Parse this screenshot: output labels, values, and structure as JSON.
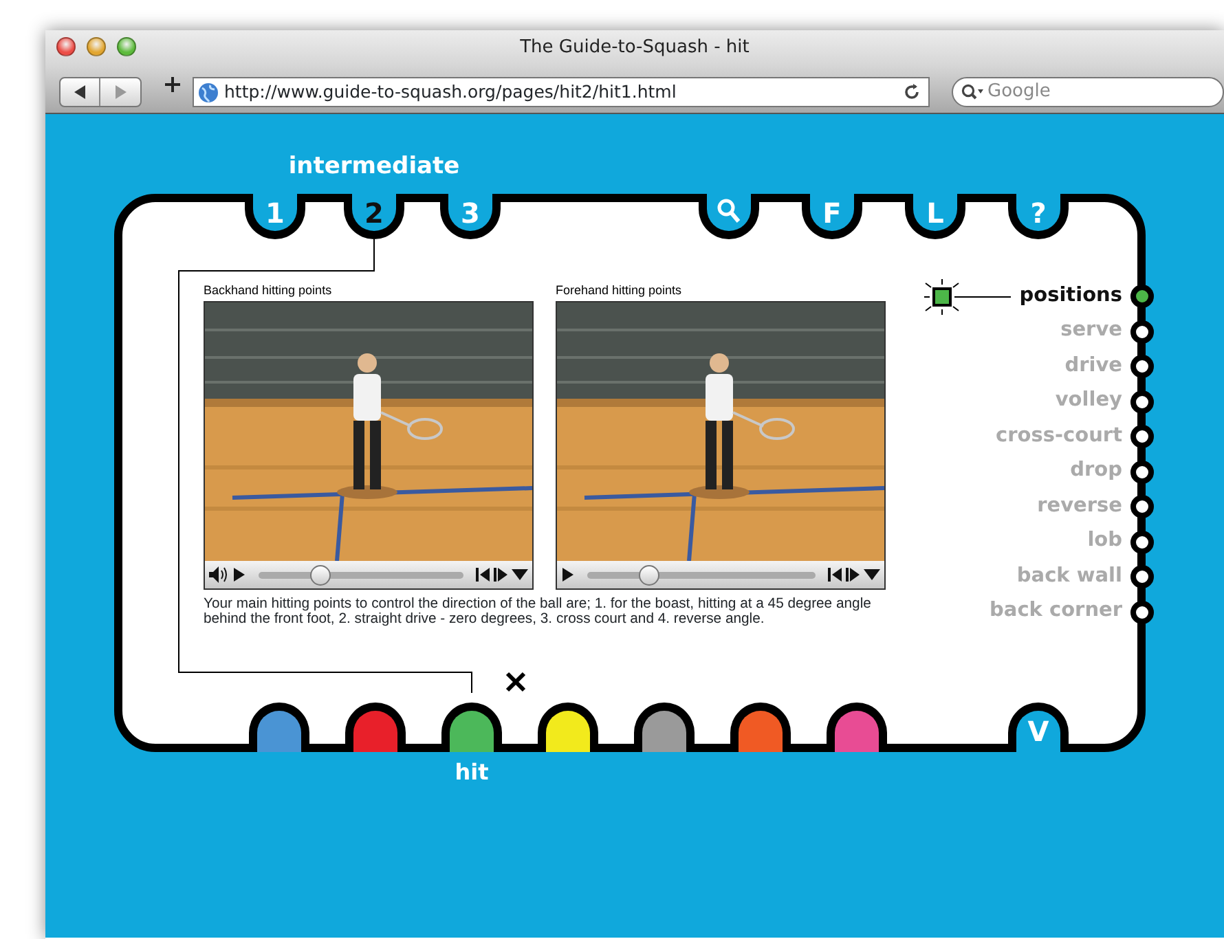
{
  "window": {
    "title": "The Guide-to-Squash - hit"
  },
  "toolbar": {
    "url": "http://www.guide-to-squash.org/pages/hit2/hit1.html",
    "search": {
      "placeholder": "Google"
    }
  },
  "level_label": "intermediate",
  "level_tabs": [
    {
      "label": "1",
      "selected": false
    },
    {
      "label": "2",
      "selected": true
    },
    {
      "label": "3",
      "selected": false
    }
  ],
  "tool_tabs": [
    {
      "kind": "search"
    },
    {
      "kind": "text",
      "label": "F"
    },
    {
      "kind": "text",
      "label": "L"
    },
    {
      "kind": "text",
      "label": "?"
    }
  ],
  "videos": [
    {
      "caption": "Backhand hitting points",
      "volume_button": true,
      "level": 0.3
    },
    {
      "caption": "Forehand hitting points",
      "volume_button": false,
      "level": 0.27
    }
  ],
  "description": "Your main hitting points to control the direction of the ball are; 1. for the boast, hitting at a 45 degree angle behind the front foot, 2. straight drive - zero degrees, 3. cross court and 4. reverse angle.",
  "topics": [
    {
      "label": "positions",
      "selected": true
    },
    {
      "label": "serve",
      "selected": false
    },
    {
      "label": "drive",
      "selected": false
    },
    {
      "label": "volley",
      "selected": false
    },
    {
      "label": "cross-court",
      "selected": false
    },
    {
      "label": "drop",
      "selected": false
    },
    {
      "label": "reverse",
      "selected": false
    },
    {
      "label": "lob",
      "selected": false
    },
    {
      "label": "back wall",
      "selected": false
    },
    {
      "label": "back corner",
      "selected": false
    }
  ],
  "sections": [
    {
      "color": "#4a94d4"
    },
    {
      "color": "#e8202a"
    },
    {
      "color": "#4cb85a",
      "label": "hit"
    },
    {
      "color": "#f2ea1c"
    },
    {
      "color": "#9a9a9a"
    },
    {
      "color": "#f05a24"
    },
    {
      "color": "#e84c94"
    }
  ],
  "next_tab": "V"
}
